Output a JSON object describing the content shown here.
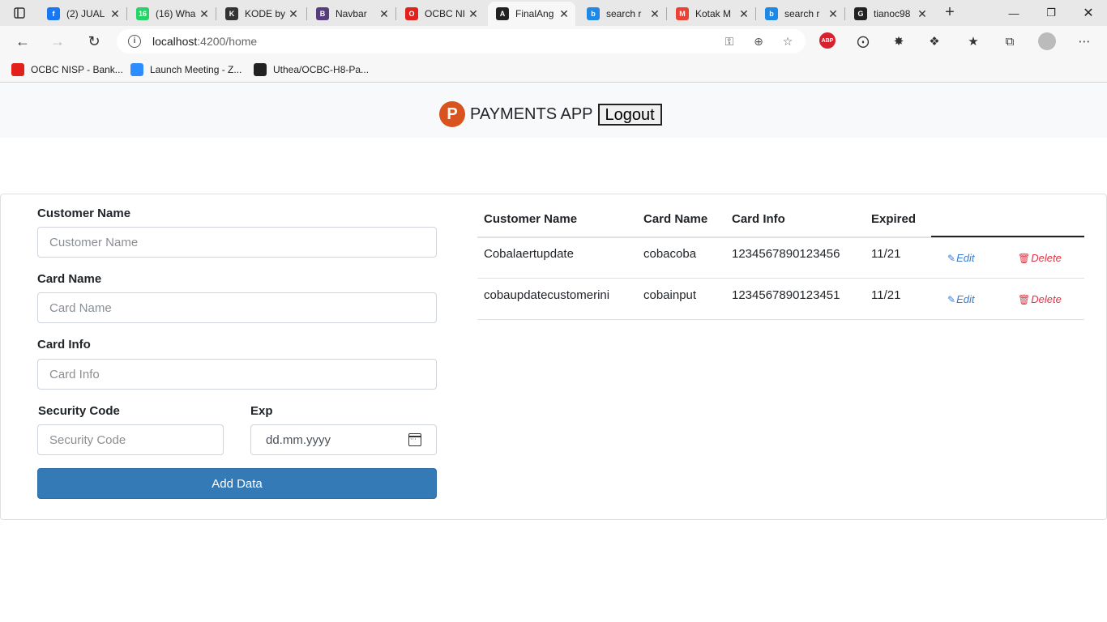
{
  "browser": {
    "tabs": [
      {
        "title": "(2) JUAL",
        "color": "#1877f2",
        "glyph": "f"
      },
      {
        "title": "(16) Wha",
        "color": "#25d366",
        "glyph": "16"
      },
      {
        "title": "KODE by",
        "color": "#333333",
        "glyph": "K"
      },
      {
        "title": "Navbar",
        "color": "#563d7c",
        "glyph": "B"
      },
      {
        "title": "OCBC NI",
        "color": "#e3211c",
        "glyph": "O"
      },
      {
        "title": "FinalAng",
        "color": "#222222",
        "glyph": "A"
      },
      {
        "title": "search r",
        "color": "#1e88e5",
        "glyph": "b"
      },
      {
        "title": "Kotak M",
        "color": "#ea4335",
        "glyph": "M"
      },
      {
        "title": "search r",
        "color": "#1e88e5",
        "glyph": "b"
      },
      {
        "title": "tianoc98",
        "color": "#222222",
        "glyph": "G"
      }
    ],
    "active_tab_index": 5,
    "url_host": "localhost",
    "url_path": ":4200/home",
    "bookmarks": [
      {
        "label": "OCBC NISP - Bank...",
        "color": "#e3211c"
      },
      {
        "label": "Launch Meeting - Z...",
        "color": "#2d8cff"
      },
      {
        "label": "Uthea/OCBC-H8-Pa...",
        "color": "#222222"
      }
    ],
    "adblock_label": "ABP"
  },
  "app": {
    "logo_letter": "P",
    "brand": "PAYMENTS APP",
    "logout_label": "Logout"
  },
  "form": {
    "customer_name": {
      "label": "Customer Name",
      "placeholder": "Customer Name"
    },
    "card_name": {
      "label": "Card Name",
      "placeholder": "Card Name"
    },
    "card_info": {
      "label": "Card Info",
      "placeholder": "Card Info"
    },
    "security_code": {
      "label": "Security Code",
      "placeholder": "Security Code"
    },
    "exp": {
      "label": "Exp",
      "placeholder": "dd.mm.yyyy"
    },
    "submit_label": "Add Data"
  },
  "table": {
    "headers": [
      "Customer Name",
      "Card Name",
      "Card Info",
      "Expired"
    ],
    "rows": [
      {
        "customer_name": "Cobalaertupdate",
        "card_name": "cobacoba",
        "card_info": "1234567890123456",
        "expired": "11/21"
      },
      {
        "customer_name": "cobaupdatecustomerini",
        "card_name": "cobainput",
        "card_info": "1234567890123451",
        "expired": "11/21"
      }
    ],
    "edit_label": "Edit",
    "delete_label": "Delete"
  }
}
